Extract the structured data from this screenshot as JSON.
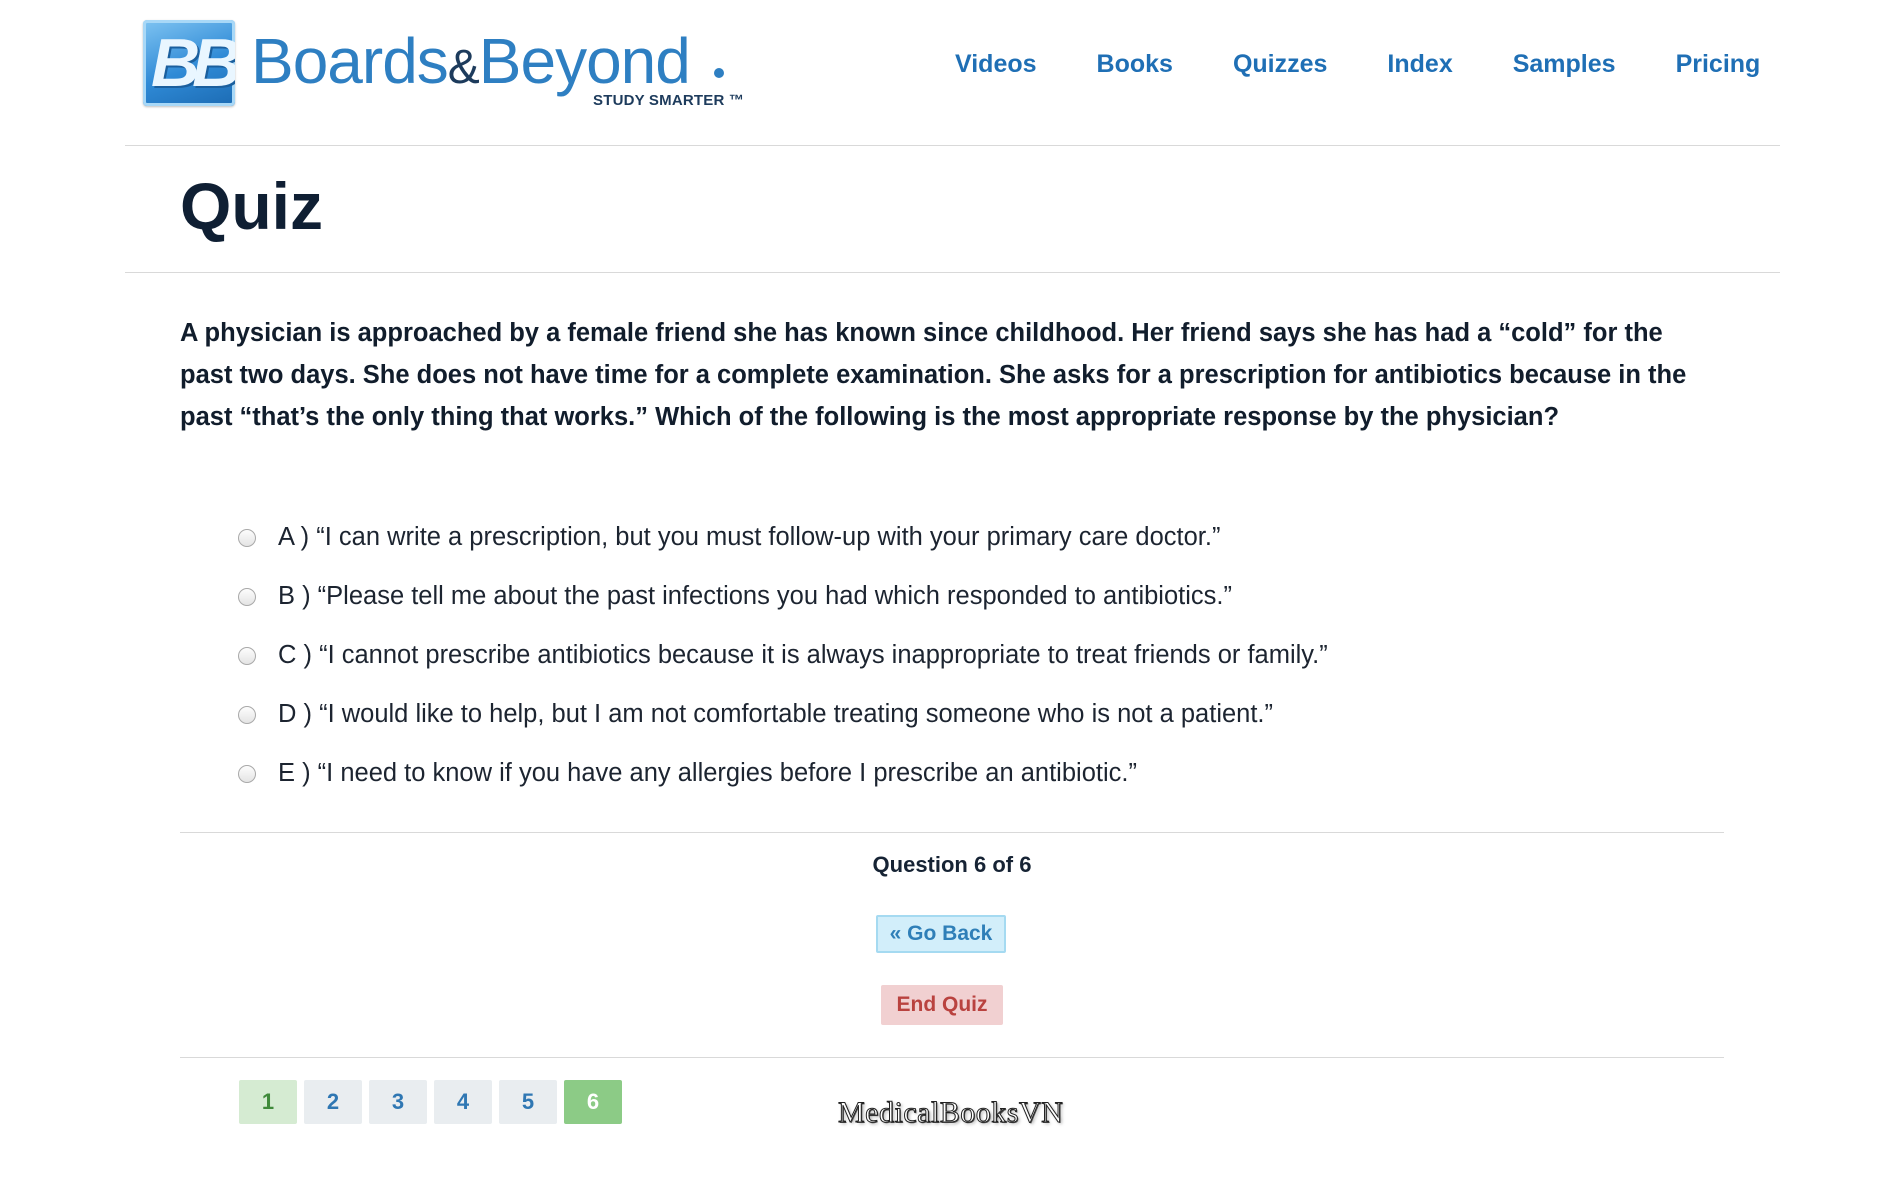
{
  "header": {
    "logo_mark": "BB",
    "logo_word_1": "Boards",
    "logo_amp": "&",
    "logo_word_2": "Beyond",
    "logo_tagline": "STUDY SMARTER ™",
    "nav": [
      "Videos",
      "Books",
      "Quizzes",
      "Index",
      "Samples",
      "Pricing"
    ]
  },
  "page": {
    "title": "Quiz"
  },
  "question": {
    "text": "A physician is approached by a female friend she has known since childhood. Her friend says she has had a “cold” for the past two days. She does not have time for a complete examination. She asks for a prescription for antibiotics because in the past “that’s the only thing that works.” Which of the following is the most appropriate response by the physician?",
    "options": [
      "A ) “I can write a prescription, but you must follow-up with your primary care doctor.”",
      "B ) “Please tell me about the past infections you had which responded to antibiotics.”",
      "C ) “I cannot prescribe antibiotics because it is always inappropriate to treat friends or family.”",
      "D ) “I would like to help, but I am not comfortable treating someone who is not a patient.”",
      "E ) “I need to know if you have any allergies before I prescribe an antibiotic.”"
    ]
  },
  "footer": {
    "counter": "Question 6 of 6",
    "go_back_label": "« Go Back",
    "end_quiz_label": "End Quiz",
    "pages": [
      "1",
      "2",
      "3",
      "4",
      "5",
      "6"
    ],
    "watermark": "MedicalBooksVN"
  },
  "colors": {
    "nav_link": "#1f6fb5",
    "go_back_bg": "#d2eefa",
    "end_quiz_bg": "#f1d0d1",
    "page_answered": "#d5ebd2",
    "page_current": "#8ccb86"
  },
  "icons": [
    "radio-button-icon"
  ]
}
